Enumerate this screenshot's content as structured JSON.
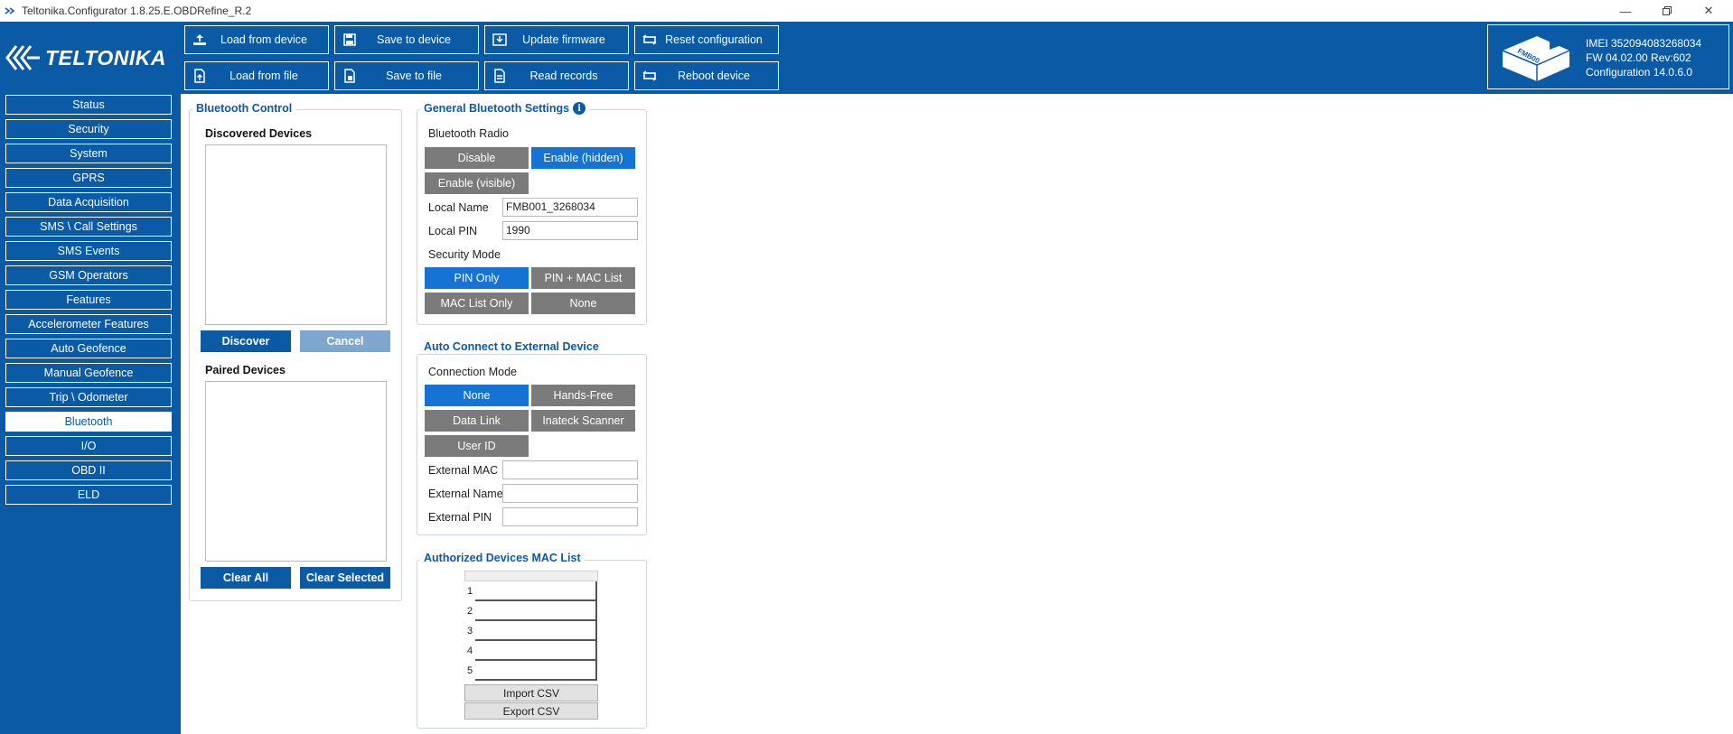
{
  "window": {
    "title": "Teltonika.Configurator 1.8.25.E.OBDRefine_R.2",
    "controls": [
      "minimize-icon",
      "restore-icon",
      "close-icon"
    ]
  },
  "brand": {
    "logo_text": "TELTONIKA"
  },
  "toolbar": {
    "load_from_device": "Load from device",
    "save_to_device": "Save to device",
    "update_firmware": "Update firmware",
    "reset_configuration": "Reset configuration",
    "load_from_file": "Load from file",
    "save_to_file": "Save to file",
    "read_records": "Read records",
    "reboot_device": "Reboot device"
  },
  "device": {
    "imei": "IMEI  352094083268034",
    "fw": "FW  04.02.00 Rev:602",
    "configuration": "Configuration  14.0.6.0",
    "model_label": "FMB00"
  },
  "sidebar": {
    "items": [
      {
        "label": "Status"
      },
      {
        "label": "Security"
      },
      {
        "label": "System"
      },
      {
        "label": "GPRS"
      },
      {
        "label": "Data Acquisition"
      },
      {
        "label": "SMS \\ Call Settings"
      },
      {
        "label": "SMS Events"
      },
      {
        "label": "GSM Operators"
      },
      {
        "label": "Features"
      },
      {
        "label": "Accelerometer Features"
      },
      {
        "label": "Auto Geofence"
      },
      {
        "label": "Manual Geofence"
      },
      {
        "label": "Trip \\ Odometer"
      },
      {
        "label": "Bluetooth"
      },
      {
        "label": "I/O"
      },
      {
        "label": "OBD II"
      },
      {
        "label": "ELD"
      }
    ],
    "active": "Bluetooth"
  },
  "bluetooth_control": {
    "title": "Bluetooth Control",
    "discovered_label": "Discovered Devices",
    "discover_button": "Discover",
    "cancel_button": "Cancel",
    "paired_label": "Paired Devices",
    "clear_all_button": "Clear All",
    "clear_selected_button": "Clear Selected"
  },
  "general_bt": {
    "title": "General Bluetooth Settings",
    "radio_label": "Bluetooth Radio",
    "radio_options": [
      "Disable",
      "Enable (hidden)",
      "Enable (visible)"
    ],
    "radio_selected": "Enable (hidden)",
    "local_name_label": "Local Name",
    "local_name_value": "FMB001_3268034",
    "local_pin_label": "Local PIN",
    "local_pin_value": "1990",
    "security_label": "Security Mode",
    "security_options": [
      "PIN Only",
      "PIN + MAC List",
      "MAC List Only",
      "None"
    ],
    "security_selected": "PIN Only"
  },
  "auto_connect": {
    "title": "Auto Connect to External Device",
    "mode_label": "Connection Mode",
    "mode_options": [
      "None",
      "Hands-Free",
      "Data Link",
      "Inateck Scanner",
      "User ID"
    ],
    "mode_selected": "None",
    "ext_mac_label": "External MAC",
    "ext_mac_value": "",
    "ext_name_label": "External Name",
    "ext_name_value": "",
    "ext_pin_label": "External PIN",
    "ext_pin_value": ""
  },
  "mac_list": {
    "title": "Authorized Devices MAC List",
    "rows": [
      "1",
      "2",
      "3",
      "4",
      "5"
    ],
    "import_button": "Import CSV",
    "export_button": "Export CSV"
  },
  "colors": {
    "brand_blue": "#0b5aa6",
    "selected_blue": "#1473d3",
    "segment_gray": "#7b7b7b"
  }
}
